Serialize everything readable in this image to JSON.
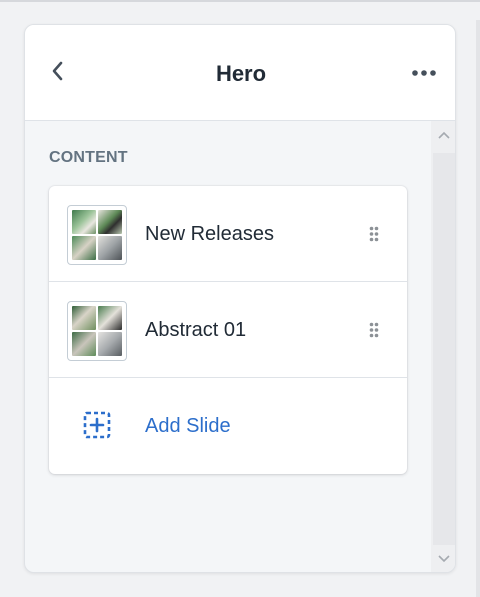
{
  "header": {
    "title": "Hero",
    "back_icon": "chevron-left-icon",
    "more_icon": "horizontal-dots-icon"
  },
  "content": {
    "section_label": "CONTENT",
    "slides": [
      {
        "label": "New Releases",
        "thumbnail": "slide-thumbnail",
        "handle_icon": "drag-handle-icon"
      },
      {
        "label": "Abstract 01",
        "thumbnail": "slide-thumbnail",
        "handle_icon": "drag-handle-icon"
      }
    ],
    "add_slide": {
      "label": "Add Slide",
      "icon": "dashed-plus-icon"
    }
  },
  "colors": {
    "accent": "#2c6ecb",
    "text": "#212b36",
    "muted": "#637381",
    "panel_bg": "#f4f6f8"
  }
}
